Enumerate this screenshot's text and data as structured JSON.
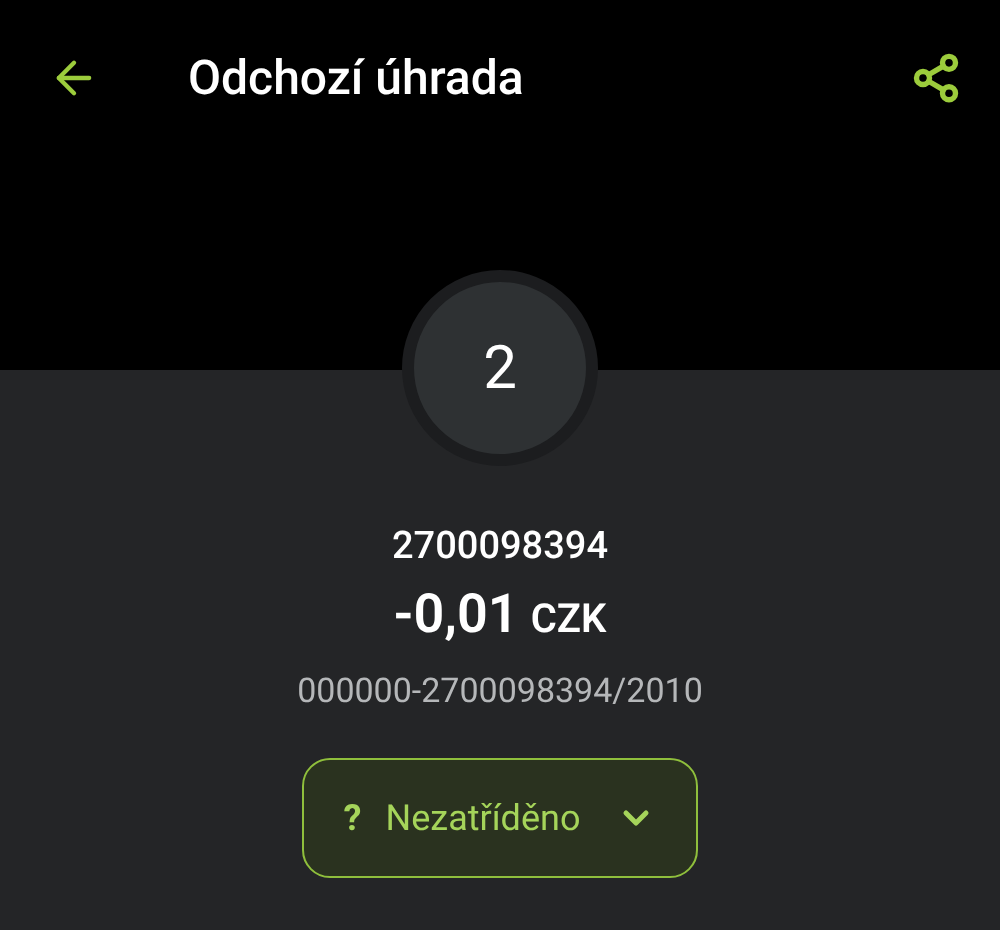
{
  "header": {
    "title": "Odchozí úhrada"
  },
  "avatar": {
    "text": "2"
  },
  "payment": {
    "account_name": "2700098394",
    "amount": "-0,01",
    "currency": "CZK",
    "account_number": "000000-2700098394/2010"
  },
  "category": {
    "icon": "?",
    "label": "Nezatříděno",
    "expanded": false
  }
}
